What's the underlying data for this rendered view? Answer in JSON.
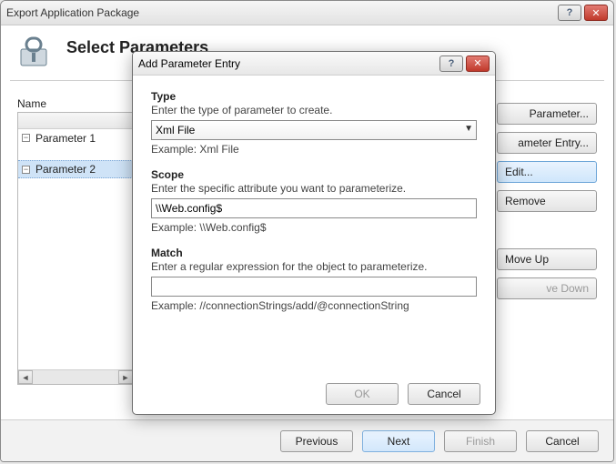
{
  "outer": {
    "title": "Export Application Package",
    "heading": "Select Parameters",
    "name_column": "Name",
    "rows": [
      {
        "label": "Parameter 1",
        "selected": false
      },
      {
        "label": "Parameter 2",
        "selected": true
      }
    ],
    "buttons": {
      "add_parameter": "Parameter...",
      "add_entry": "ameter Entry...",
      "edit": "Edit...",
      "remove": "Remove",
      "move_up": "Move Up",
      "move_down": "ve Down"
    },
    "footer": {
      "previous": "Previous",
      "next": "Next",
      "finish": "Finish",
      "cancel": "Cancel"
    }
  },
  "dialog": {
    "title": "Add Parameter Entry",
    "type": {
      "label": "Type",
      "desc": "Enter the type of parameter to create.",
      "value": "Xml File",
      "example": "Example: Xml File"
    },
    "scope": {
      "label": "Scope",
      "desc": "Enter the specific attribute you want to parameterize.",
      "value": "\\\\Web.config$",
      "example": "Example: \\\\Web.config$"
    },
    "match": {
      "label": "Match",
      "desc": "Enter a regular expression for the object to parameterize.",
      "value": "",
      "example": "Example: //connectionStrings/add/@connectionString"
    },
    "footer": {
      "ok": "OK",
      "cancel": "Cancel"
    }
  }
}
